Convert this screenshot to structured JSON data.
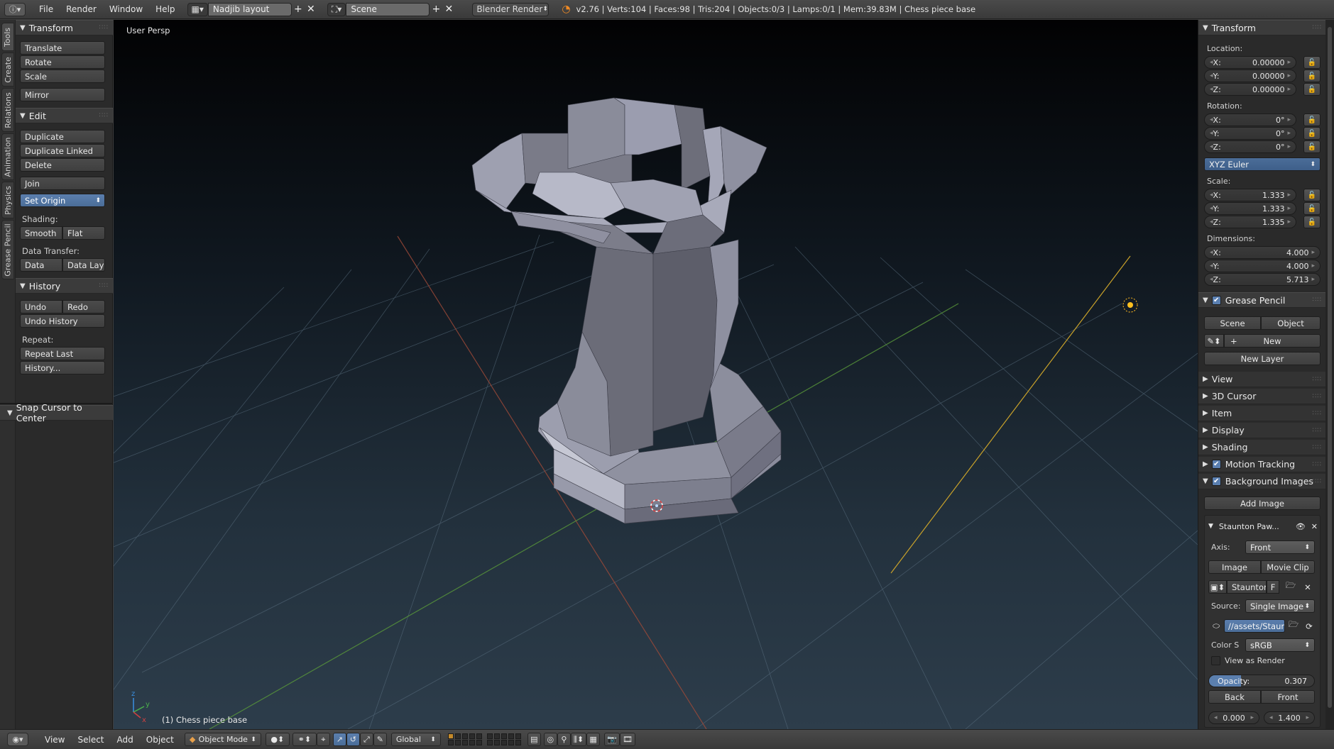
{
  "topbar": {
    "menus": [
      "File",
      "Render",
      "Window",
      "Help"
    ],
    "layout": "Nadjib layout",
    "scene": "Scene",
    "engine": "Blender Render",
    "stats": "v2.76 | Verts:104 | Faces:98 | Tris:204 | Objects:0/3 | Lamps:0/1 | Mem:39.83M | Chess piece base"
  },
  "tabs": [
    "Tools",
    "Create",
    "Relations",
    "Animation",
    "Physics",
    "Grease Pencil"
  ],
  "toolshelf": {
    "transform": {
      "title": "Transform",
      "translate": "Translate",
      "rotate": "Rotate",
      "scale": "Scale",
      "mirror": "Mirror"
    },
    "edit": {
      "title": "Edit",
      "duplicate": "Duplicate",
      "duplicate_linked": "Duplicate Linked",
      "delete": "Delete",
      "join": "Join",
      "set_origin": "Set Origin",
      "shading_label": "Shading:",
      "smooth": "Smooth",
      "flat": "Flat",
      "data_transfer_label": "Data Transfer:",
      "data": "Data",
      "data_layo": "Data Layo"
    },
    "history": {
      "title": "History",
      "undo": "Undo",
      "redo": "Redo",
      "undo_history": "Undo History",
      "repeat_label": "Repeat:",
      "repeat_last": "Repeat Last",
      "history": "History..."
    },
    "operator": "Snap Cursor to Center"
  },
  "viewport": {
    "view_name": "User Persp",
    "object_label": "(1) Chess piece base"
  },
  "properties": {
    "transform": {
      "title": "Transform",
      "location_label": "Location:",
      "location": [
        "0.00000",
        "0.00000",
        "0.00000"
      ],
      "rotation_label": "Rotation:",
      "rotation": [
        "0°",
        "0°",
        "0°"
      ],
      "rotation_mode": "XYZ Euler",
      "scale_label": "Scale:",
      "scale": [
        "1.333",
        "1.333",
        "1.335"
      ],
      "dimensions_label": "Dimensions:",
      "dimensions": [
        "4.000",
        "4.000",
        "5.713"
      ],
      "axes": [
        "X:",
        "Y:",
        "Z:"
      ]
    },
    "grease_pencil": {
      "title": "Grease Pencil",
      "scene": "Scene",
      "object": "Object",
      "new": "New",
      "new_layer": "New Layer"
    },
    "collapsed": [
      "View",
      "3D Cursor",
      "Item",
      "Display",
      "Shading"
    ],
    "motion_tracking": "Motion Tracking",
    "background_images": {
      "title": "Background Images",
      "add_image": "Add Image",
      "image_name": "Staunton Paw...",
      "axis_label": "Axis:",
      "axis_value": "Front",
      "image_tab": "Image",
      "movie_clip_tab": "Movie Clip",
      "datablock": "Staunton",
      "datablock_flag": "F",
      "source_label": "Source:",
      "source_value": "Single Image",
      "filepath": "//assets/Staun...",
      "color_label": "Color S",
      "color_value": "sRGB",
      "view_as_render": "View as Render",
      "opacity_label": "Opacity:",
      "opacity_value": "0.307",
      "opacity_fraction": 0.307,
      "back": "Back",
      "front": "Front",
      "offset_x": "0.000",
      "offset_y": "1.400"
    }
  },
  "bottombar": {
    "menus": [
      "View",
      "Select",
      "Add",
      "Object"
    ],
    "mode": "Object Mode",
    "orientation": "Global"
  },
  "colors": {
    "accent": "#5b7fae",
    "viewport_top": "#020203",
    "viewport_bottom": "#2d3d4b",
    "mesh_light": "#b4b6c8",
    "mesh_dark": "#5e5f6c",
    "lamp": "#ffc020"
  }
}
